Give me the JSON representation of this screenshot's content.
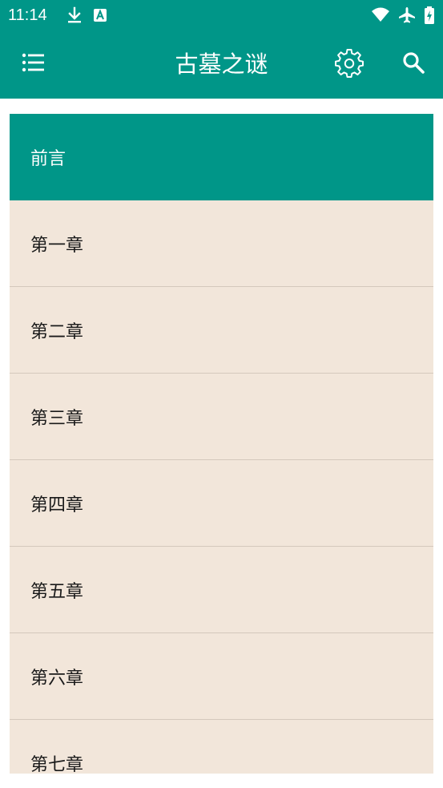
{
  "status_bar": {
    "time": "11:14"
  },
  "app_bar": {
    "title": "古墓之谜",
    "menu_icon": "list-icon",
    "settings_icon": "gear-icon",
    "search_icon": "search-icon"
  },
  "chapters": [
    {
      "label": "前言",
      "selected": true
    },
    {
      "label": "第一章",
      "selected": false
    },
    {
      "label": "第二章",
      "selected": false
    },
    {
      "label": "第三章",
      "selected": false
    },
    {
      "label": "第四章",
      "selected": false
    },
    {
      "label": "第五章",
      "selected": false
    },
    {
      "label": "第六章",
      "selected": false
    },
    {
      "label": "第七章",
      "selected": false
    }
  ],
  "colors": {
    "primary": "#009688",
    "list_background": "#f2e6da",
    "divider": "#d4c8bc",
    "selected_text": "#ffffff",
    "text": "#1a1a1a"
  }
}
